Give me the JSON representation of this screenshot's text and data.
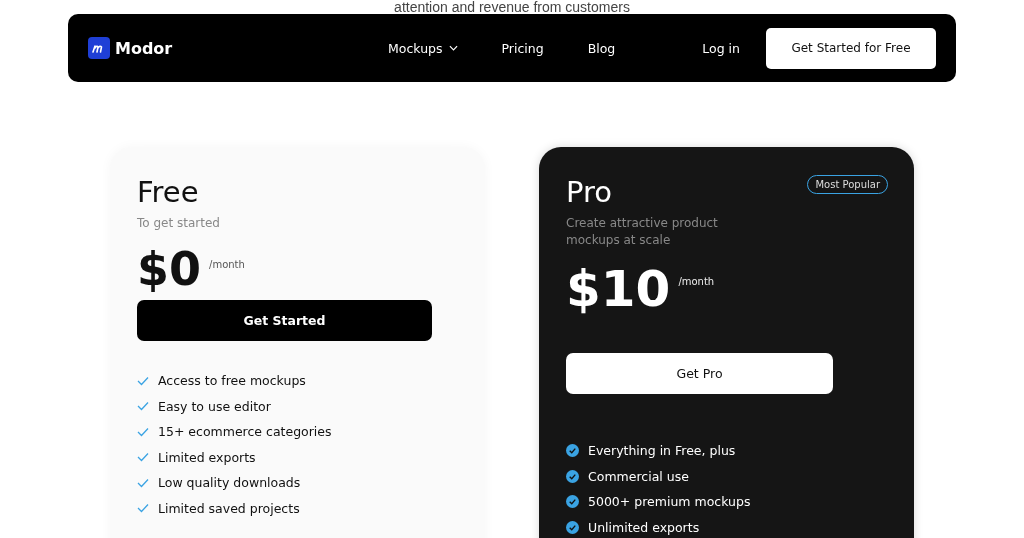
{
  "headline": "attention and revenue from customers",
  "nav": {
    "brand": "Modor",
    "links": [
      {
        "label": "Mockups",
        "dropdown": true
      },
      {
        "label": "Pricing",
        "dropdown": false
      },
      {
        "label": "Blog",
        "dropdown": false
      }
    ],
    "login": "Log in",
    "cta": "Get Started for Free"
  },
  "plans": [
    {
      "kind": "light",
      "name": "Free",
      "subtitle": "To get started",
      "price": "$0",
      "period": "/month",
      "button": "Get Started",
      "features": [
        "Access to free mockups",
        "Easy to use editor",
        "15+ ecommerce categories",
        "Limited exports",
        "Low quality downloads",
        "Limited saved projects"
      ]
    },
    {
      "kind": "dark",
      "name": "Pro",
      "badge": "Most Popular",
      "subtitle": "Create attractive product mockups at scale",
      "price": "$10",
      "period": "/month",
      "button": "Get Pro",
      "features": [
        "Everything in Free, plus",
        "Commercial use",
        "5000+ premium mockups",
        "Unlimited exports"
      ]
    }
  ]
}
